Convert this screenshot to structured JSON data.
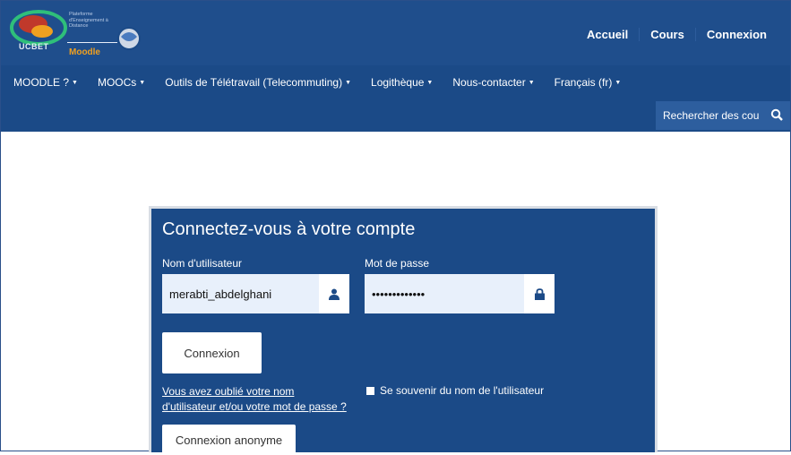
{
  "header": {
    "logo": {
      "acronym": "UCBET",
      "product": "Moodle",
      "tagline": "Plateforme d'Enseignement à Distance"
    },
    "links": [
      "Accueil",
      "Cours",
      "Connexion"
    ]
  },
  "nav": {
    "items": [
      {
        "label": "MOODLE ?",
        "icon": "caret-down"
      },
      {
        "label": "MOOCs",
        "icon": "caret-down"
      },
      {
        "label": "Outils de Télétravail (Telecommuting)",
        "icon": "caret-down"
      },
      {
        "label": "Logithèque",
        "icon": "caret-down"
      },
      {
        "label": "Nous-contacter",
        "icon": "caret-down"
      },
      {
        "label": "Français (fr)",
        "icon": "caret-down"
      }
    ],
    "search": {
      "placeholder": "Rechercher des cou",
      "icon": "search-icon"
    }
  },
  "login": {
    "title": "Connectez-vous à votre compte",
    "username_label": "Nom d'utilisateur",
    "username_value": "merabti_abdelghani",
    "username_icon": "user-icon",
    "password_label": "Mot de passe",
    "password_value": "•••••••••••••",
    "password_icon": "lock-icon",
    "submit": "Connexion",
    "forgot_line1": "Vous avez oublié votre nom",
    "forgot_line2": "d'utilisateur et/ou votre mot de passe ?",
    "remember": "Se souvenir du nom de l'utilisateur",
    "anonymous": "Connexion anonyme"
  },
  "colors": {
    "brand": "#1f4e8c",
    "nav": "#1b4a87"
  }
}
